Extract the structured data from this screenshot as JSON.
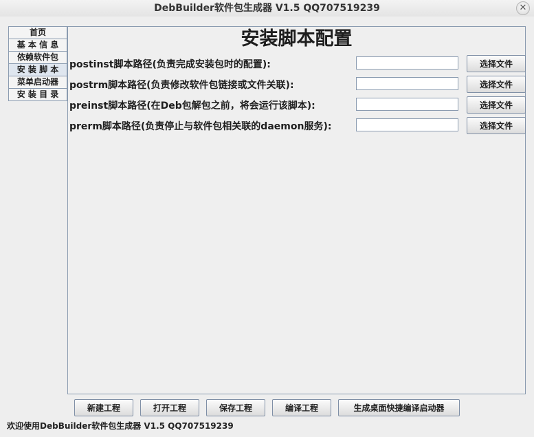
{
  "window": {
    "title": "DebBuilder软件包生成器 V1.5 QQ707519239",
    "close_glyph": "✕"
  },
  "tabs": [
    {
      "label": "首页"
    },
    {
      "label": "基 本 信 息"
    },
    {
      "label": "依赖软件包"
    },
    {
      "label": "安 装 脚 本"
    },
    {
      "label": "菜单启动器"
    },
    {
      "label": "安 装 目 录"
    }
  ],
  "active_tab": "安 装 脚 本",
  "main": {
    "title": "安装脚本配置",
    "rows": [
      {
        "label": "postinst脚本路径(负责完成安装包时的配置):",
        "value": "",
        "button": "选择文件"
      },
      {
        "label": "postrm脚本路径(负责修改软件包链接或文件关联):",
        "value": "",
        "button": "选择文件"
      },
      {
        "label": "preinst脚本路径(在Deb包解包之前，将会运行该脚本):",
        "value": "",
        "button": "选择文件"
      },
      {
        "label": "prerm脚本路径(负责停止与软件包相关联的daemon服务):",
        "value": "",
        "button": "选择文件"
      }
    ]
  },
  "bottom_buttons": {
    "new": "新建工程",
    "open": "打开工程",
    "save": "保存工程",
    "compile": "编译工程",
    "shortcut": "生成桌面快捷编译启动器"
  },
  "status": {
    "text": "欢迎使用DebBuilder软件包生成器 V1.5 QQ707519239"
  }
}
